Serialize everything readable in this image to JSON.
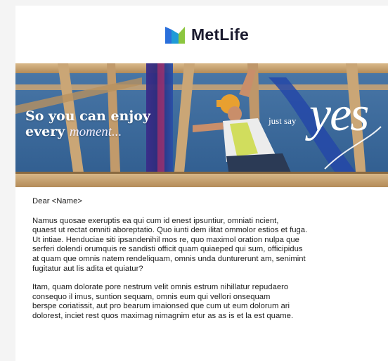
{
  "header": {
    "logo_icon": "metlife-logo-icon",
    "brand_name": "MetLife",
    "colors": {
      "blue": "#2a6fdb",
      "green": "#8cc63f",
      "navy": "#1a1a2e"
    }
  },
  "hero": {
    "headline_line1": "So you can enjoy",
    "headline_line2_prefix": "every ",
    "headline_line2_script": "moment...",
    "tagline_small": "just say",
    "tagline_large": "yes"
  },
  "body": {
    "salutation": "Dear <Name>",
    "paragraphs": [
      "Namus quosae exeruptis ea qui cum id enest ipsuntiur, omniati ncient,\nquaest ut rectat omniti aboreptatio. Quo iunti dem ilitat ommolor estios et fuga.\nUt intiae. Henduciae siti ipsandenihil mos re, quo maximol oration nulpa que\nserferi dolendi orumquis re sandisti officit quam quiaeped qui sum, officipidus\nat quam que omnis natem rendeliquam, omnis unda dunturerunt am, senimint\nfugitatur aut lis adita et quiatur?",
      "Itam, quam dolorate pore nestrum velit omnis estrum nihillatur repudaero\nconsequo il imus, suntion sequam, omnis eum qui vellori onsequam\n berspe coriatissit, aut pro bearum imaionsed que cum ut eum dolorum ari\ndolorest, inciet rest quos maximag nimagnim etur as as is et la est quame."
    ]
  }
}
